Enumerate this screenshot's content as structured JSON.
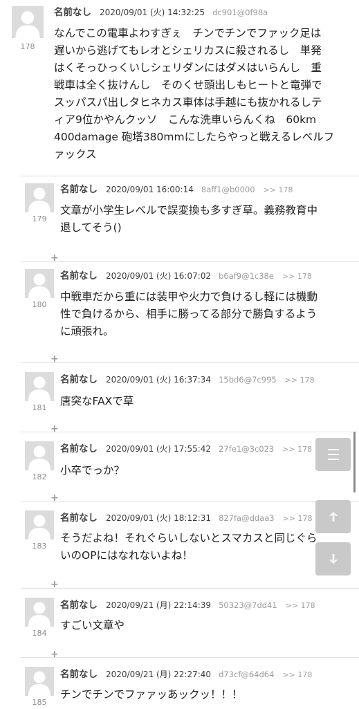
{
  "posts": [
    {
      "number": "178",
      "name": "名前なし",
      "date": "2020/09/01 (火) 14:32:25",
      "id": "dc901@0f98a",
      "reply_to": "",
      "lines": [
        "なんでこの電車よわすぎぇ　チンでチンでファック足は",
        "遅いから逃げてもレオとシェリカスに殺されるし　単発",
        "はくそっひっくいしシェリダンにはダメはいらんし　重",
        "戦車は全く抜けんし　そのくせ頭出しもヒートと竜弾で",
        "スッパスパ出しタヒネカス車体は手越にも抜かれるしテ",
        "ィア9位かやんクッソ　こんな洗車いらんくね　60km",
        "400damage 砲塔380mmにしたらやっと戦えるレベルフ",
        "ァックス"
      ]
    },
    {
      "number": "179",
      "name": "名前なし",
      "date": "2020/09/01 16:00:14",
      "id": "8aff1@b0000",
      "reply_to": ">> 178",
      "lines": [
        "文章が小学生レベルで誤変換も多すぎ草。義務教育中",
        "退してそう()"
      ]
    },
    {
      "number": "180",
      "name": "名前なし",
      "date": "2020/09/01 (火) 16:07:02",
      "id": "b6af9@1c38e",
      "reply_to": ">> 178",
      "lines": [
        "中戦車だから重には装甲や火力で負けるし軽には機動",
        "性で負けるから、相手に勝ってる部分で勝負するよう",
        "に頑張れ。"
      ]
    },
    {
      "number": "181",
      "name": "名前なし",
      "date": "2020/09/01 (火) 16:37:34",
      "id": "15bd6@7c995",
      "reply_to": ">> 178",
      "lines": [
        "唐突なFAXで草"
      ]
    },
    {
      "number": "182",
      "name": "名前なし",
      "date": "2020/09/01 (火) 17:55:42",
      "id": "27fe1@3c023",
      "reply_to": ">> 178",
      "lines": [
        "小卒でっか？"
      ]
    },
    {
      "number": "183",
      "name": "名前なし",
      "date": "2020/09/01 (火) 18:12:31",
      "id": "827fa@ddaa3",
      "reply_to": ">> 178",
      "lines": [
        "そうだよね！それぐらいしないとスマカスと同じぐら",
        "いのOPにはなれないよね！"
      ]
    },
    {
      "number": "184",
      "name": "名前なし",
      "date": "2020/09/21 (月) 22:14:39",
      "id": "50323@7dd41",
      "reply_to": ">> 178",
      "lines": [
        "すごい文章や"
      ]
    },
    {
      "number": "185",
      "name": "名前なし",
      "date": "2020/09/21 (月) 22:27:40",
      "id": "d73cf@64d64",
      "reply_to": ">> 178",
      "lines": [
        "チンでチンでファァッあックッ！！！"
      ]
    }
  ],
  "plus_label": "+",
  "floating_buttons": {
    "menu_icon": "hamburger-menu-icon",
    "up_icon": "arrow-up-icon",
    "down_icon": "arrow-down-icon",
    "button_color": "#c9c9c9"
  }
}
